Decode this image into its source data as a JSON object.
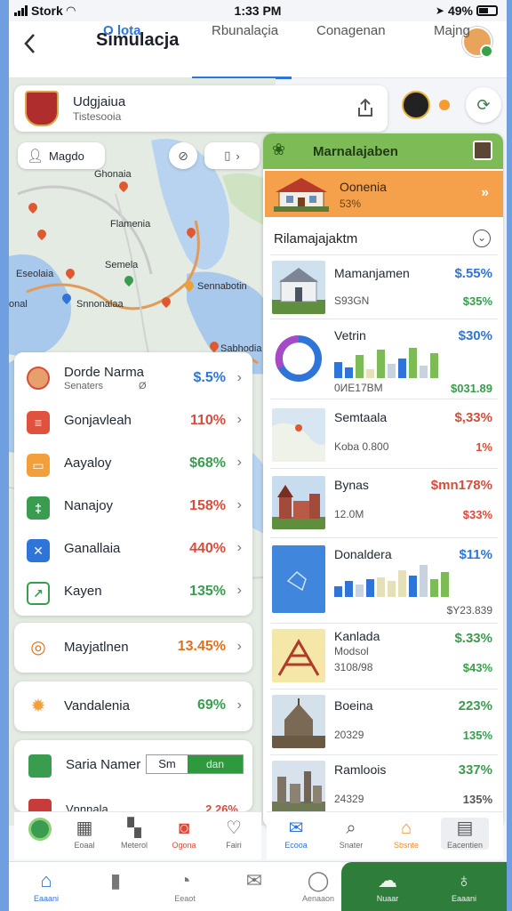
{
  "status": {
    "carrier": "Stork",
    "time": "1:33 PM",
    "battery": "49%"
  },
  "header": {
    "title": "Simulacja",
    "tabs": [
      {
        "label": "O lota",
        "active": true
      },
      {
        "label": "Rbunalaçia",
        "active": false
      },
      {
        "label": "Conagenan",
        "active": false
      },
      {
        "label": "Majng",
        "active": false
      }
    ]
  },
  "location": {
    "title": "Udgjaiua",
    "subtitle": "Tistesooia"
  },
  "map": {
    "filter_label": "Magdo",
    "labels": [
      "Ghonaia",
      "Flamenia",
      "Semela",
      "Sennabotin",
      "Eseolaia",
      "onal",
      "Snnonalaa",
      "Sabhodia"
    ]
  },
  "left_list": [
    {
      "name": "Dorde Narma",
      "sub": "Senaters",
      "sub2": "Ø",
      "value": "$.5%",
      "color": "#2f74d8",
      "icon": "avatar-icon"
    },
    {
      "name": "Gonjavleah",
      "value": "110%",
      "color": "#d94b3b",
      "icon": "receipt-icon",
      "icon_bg": "#e0523e"
    },
    {
      "name": "Aayaloy",
      "value": "$68%",
      "color": "#3a9c4f",
      "icon": "wallet-icon",
      "icon_bg": "#f2a03b"
    },
    {
      "name": "Nanajoy",
      "value": "158%",
      "color": "#d94b3b",
      "icon": "tax-icon",
      "icon_bg": "#3a9c4f"
    },
    {
      "name": "Ganallaia",
      "value": "440%",
      "color": "#d94b3b",
      "icon": "close-square-icon",
      "icon_bg": "#2f74d8"
    },
    {
      "name": "Kayen",
      "value": "135%",
      "color": "#3a9c4f",
      "icon": "chart-up-icon",
      "icon_bg": "#ffffff"
    }
  ],
  "cards": [
    {
      "name": "Mayjatlnen",
      "value": "13.45%",
      "color": "#e0701f"
    },
    {
      "name": "Vandalenia",
      "value": "69%",
      "color": "#3a9c4f"
    }
  ],
  "scan_card": {
    "name": "Saria Namer",
    "box_left": "Sm",
    "box_right": "dan",
    "sub2": "Vnnnala",
    "value2": "2.26%"
  },
  "right_panel": {
    "header": "Marnalajaben",
    "featured": {
      "name": "Oonenia",
      "sub": "53%"
    },
    "section_title": "Rilamajajaktm",
    "items": [
      {
        "name": "Mamanjamen",
        "sub": "S93GN",
        "value": "$.55%",
        "value2": "$35%",
        "val_color": "#2f74d8",
        "val2_color": "#3a9c4f",
        "thumb": "mansion"
      },
      {
        "name": "Vetrin",
        "sub": "0ИЕ17ВМ",
        "value": "$30%",
        "value2": "$031.89",
        "val_color": "#2f74d8",
        "val2_color": "#3a9c4f",
        "thumb": "donut"
      },
      {
        "name": "Semtaala",
        "sub": "Koba 0.800",
        "value": "$,33%",
        "value2": "1%",
        "val_color": "#d94b3b",
        "val2_color": "#d94b3b",
        "thumb": "map"
      },
      {
        "name": "Bynas",
        "sub": "12.0M",
        "value": "$mn178%",
        "value2": "$33%",
        "val_color": "#d94b3b",
        "val2_color": "#d94b3b",
        "thumb": "castle"
      },
      {
        "name": "Donaldera",
        "sub": "",
        "value": "$11%",
        "value2": "$Y23.839",
        "val_color": "#2f74d8",
        "val2_color": "#555555",
        "thumb": "bluemap"
      },
      {
        "name": "Kanlada",
        "sub": "Modsol",
        "sub2": "3108/98",
        "value": "$.33%",
        "value2": "$43%",
        "val_color": "#3a9c4f",
        "val2_color": "#3a9c4f",
        "thumb": "tower"
      },
      {
        "name": "Boeina",
        "sub": "20329",
        "value": "223%",
        "value2": "135%",
        "val_color": "#3a9c4f",
        "val2_color": "#3a9c4f",
        "thumb": "temple"
      },
      {
        "name": "Ramloois",
        "sub": "24329",
        "value": "337%",
        "value2": "135%",
        "val_color": "#3a9c4f",
        "val2_color": "#555555",
        "thumb": "city"
      }
    ]
  },
  "toolbar_left": [
    {
      "label": "",
      "icon": "leaf-circle-icon"
    },
    {
      "label": "Eoaal",
      "icon": "building-icon"
    },
    {
      "label": "Meterol",
      "icon": "map-icon"
    },
    {
      "label": "Ogona",
      "icon": "camera-icon",
      "color": "#d94b3b"
    },
    {
      "label": "Fairi",
      "icon": "people-icon"
    }
  ],
  "toolbar_right": [
    {
      "label": "Ecooa",
      "icon": "mail-icon",
      "color": "#2f74d8"
    },
    {
      "label": "Snater",
      "icon": "search-icon"
    },
    {
      "label": "Sbsnte",
      "icon": "home-icon",
      "color": "#f28f2f"
    },
    {
      "label": "Eacentien",
      "icon": "grid-icon"
    }
  ],
  "bottom_nav": [
    {
      "label": "Eaaani",
      "icon": "home-icon",
      "active": true
    },
    {
      "label": "",
      "icon": "bookmark-icon",
      "active": false
    },
    {
      "label": "Eeaot",
      "icon": "bell-icon",
      "active": false
    },
    {
      "label": "",
      "icon": "mail-icon",
      "active": false
    },
    {
      "label": "Aenaaon",
      "icon": "user-icon",
      "active": false
    },
    {
      "label": "Nuaar",
      "icon": "cloud-icon",
      "active": false
    },
    {
      "label": "Eaaani",
      "icon": "lightbulb-icon",
      "active": false
    }
  ]
}
